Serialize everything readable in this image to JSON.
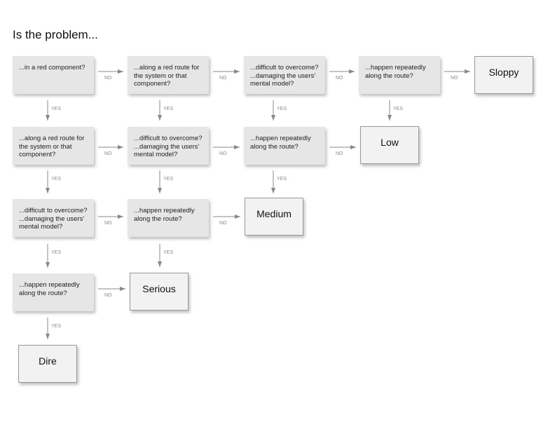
{
  "title": "Is the problem...",
  "questions": {
    "red_component": "...in a red component?",
    "red_route": "...along a red route for the system or that component?",
    "difficult": "...difficult to overcome? ...damaging the users' mental model?",
    "repeated": "...happen repeatedly along the route?"
  },
  "outcomes": {
    "sloppy": "Sloppy",
    "low": "Low",
    "medium": "Medium",
    "serious": "Serious",
    "dire": "Dire"
  },
  "labels": {
    "yes": "YES",
    "no": "NO"
  },
  "colors": {
    "question_fill": "#e6e6e6",
    "outcome_fill": "#f2f2f2",
    "arrow": "#888888"
  }
}
